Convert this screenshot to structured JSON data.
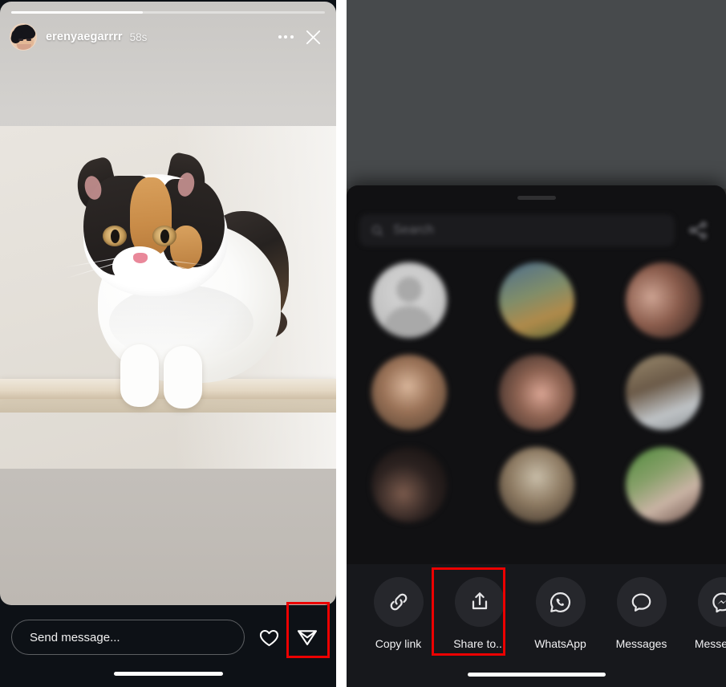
{
  "story": {
    "username": "erenyaegarrrr",
    "timestamp": "58s",
    "progress_percent": 42,
    "avatar_alt": "profile-avatar",
    "more_options_label": "More options",
    "close_label": "Close"
  },
  "story_actions": {
    "message_placeholder": "Send message...",
    "like_label": "Like",
    "send_label": "Share"
  },
  "share_sheet": {
    "search_placeholder": "Search",
    "contacts": [
      {
        "name": "",
        "subname": ""
      },
      {
        "name": "",
        "subname": ""
      },
      {
        "name": "",
        "subname": ""
      },
      {
        "name": "",
        "subname": ""
      },
      {
        "name": "",
        "subname": ""
      },
      {
        "name": "",
        "subname": ""
      },
      {
        "name": "",
        "subname": ""
      },
      {
        "name": "",
        "subname": ""
      },
      {
        "name": "",
        "subname": ""
      }
    ],
    "actions": [
      {
        "id": "copy-link",
        "label": "Copy link",
        "icon": "link-icon"
      },
      {
        "id": "share-to",
        "label": "Share to...",
        "icon": "share-upload-icon"
      },
      {
        "id": "whatsapp",
        "label": "WhatsApp",
        "icon": "whatsapp-icon"
      },
      {
        "id": "messages",
        "label": "Messages",
        "icon": "message-bubble-icon"
      },
      {
        "id": "messenger",
        "label": "Messenger",
        "icon": "messenger-icon"
      }
    ]
  },
  "highlights": {
    "accent_color": "#ec0000",
    "send_button": "send-share-button",
    "share_to_button": "share-to-button"
  }
}
